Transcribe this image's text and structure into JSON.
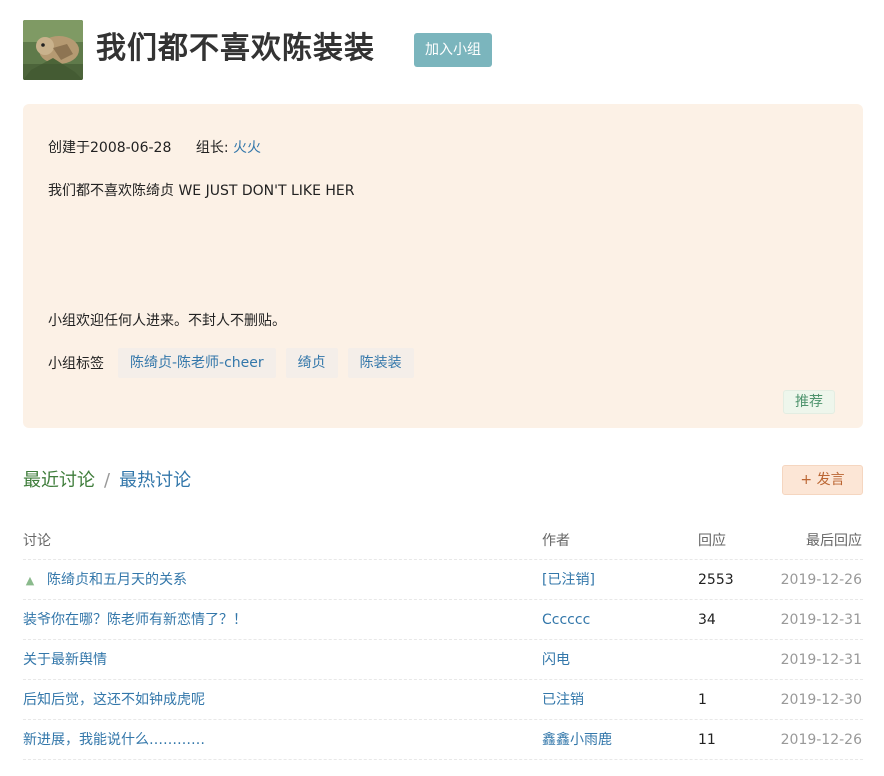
{
  "group": {
    "title": "我们都不喜欢陈装装",
    "join_label": "加入小组",
    "created": "创建于2008-06-28",
    "leader_label": "组长:",
    "leader_name": "火火",
    "description": "我们都不喜欢陈绮贞 WE JUST DON'T LIKE HER",
    "welcome": "小组欢迎任何人进来。不封人不删贴。",
    "tags_label": "小组标签",
    "tags": [
      "陈绮贞-陈老师-cheer",
      "绮贞",
      "陈装装"
    ],
    "recommend_label": "推荐"
  },
  "discussions": {
    "tab_recent": "最近讨论",
    "separator": "/",
    "tab_hot": "最热讨论",
    "post_label": "+ 发言",
    "columns": {
      "title": "讨论",
      "author": "作者",
      "replies": "回应",
      "last": "最后回应"
    },
    "rows": [
      {
        "title": "陈绮贞和五月天的关系",
        "author": "[已注销]",
        "replies": "2553",
        "last": "2019-12-26",
        "pinned": true
      },
      {
        "title": "装爷你在哪？陈老师有新恋情了？！",
        "author": "Cccccc",
        "replies": "34",
        "last": "2019-12-31"
      },
      {
        "title": "关于最新舆情",
        "author": "闪电",
        "replies": "",
        "last": "2019-12-31"
      },
      {
        "title": "后知后觉，这还不如钟成虎呢",
        "author": "已注销",
        "replies": "1",
        "last": "2019-12-30"
      },
      {
        "title": "新进展，我能说什么…………",
        "author": "鑫鑫小雨鹿",
        "replies": "11",
        "last": "2019-12-26"
      }
    ]
  },
  "colors": {
    "accent_teal": "#7bb5bd",
    "info_bg": "#fcf1e6",
    "link": "#3377aa",
    "recent_green": "#3f7d3b"
  },
  "icons": {
    "pinned": "pin-up-arrow-icon"
  }
}
